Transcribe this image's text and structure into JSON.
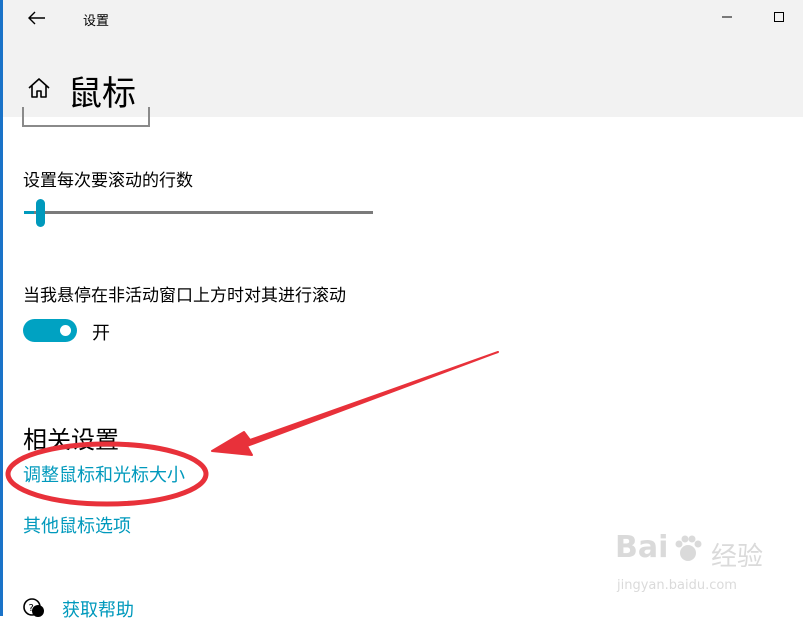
{
  "window": {
    "title": "设置"
  },
  "header": {
    "page_title": "鼠标"
  },
  "scroll_lines": {
    "label": "设置每次要滚动的行数",
    "value_fraction": 0.03
  },
  "inactive_scroll": {
    "label": "当我悬停在非活动窗口上方时对其进行滚动",
    "toggle_state": "开"
  },
  "related": {
    "heading": "相关设置",
    "links": [
      {
        "label": "调整鼠标和光标大小"
      },
      {
        "label": "其他鼠标选项"
      }
    ]
  },
  "help": {
    "label": "获取帮助"
  },
  "colors": {
    "accent": "#0099bc",
    "annotation": "#e8313a"
  },
  "icons": {
    "back": "back-arrow-icon",
    "home": "home-icon",
    "help": "help-chat-icon",
    "minimize": "minimize-icon",
    "maximize": "maximize-icon"
  },
  "watermark": {
    "brand": "Bai",
    "brand2": "经验",
    "url": "jingyan.baidu.com"
  }
}
